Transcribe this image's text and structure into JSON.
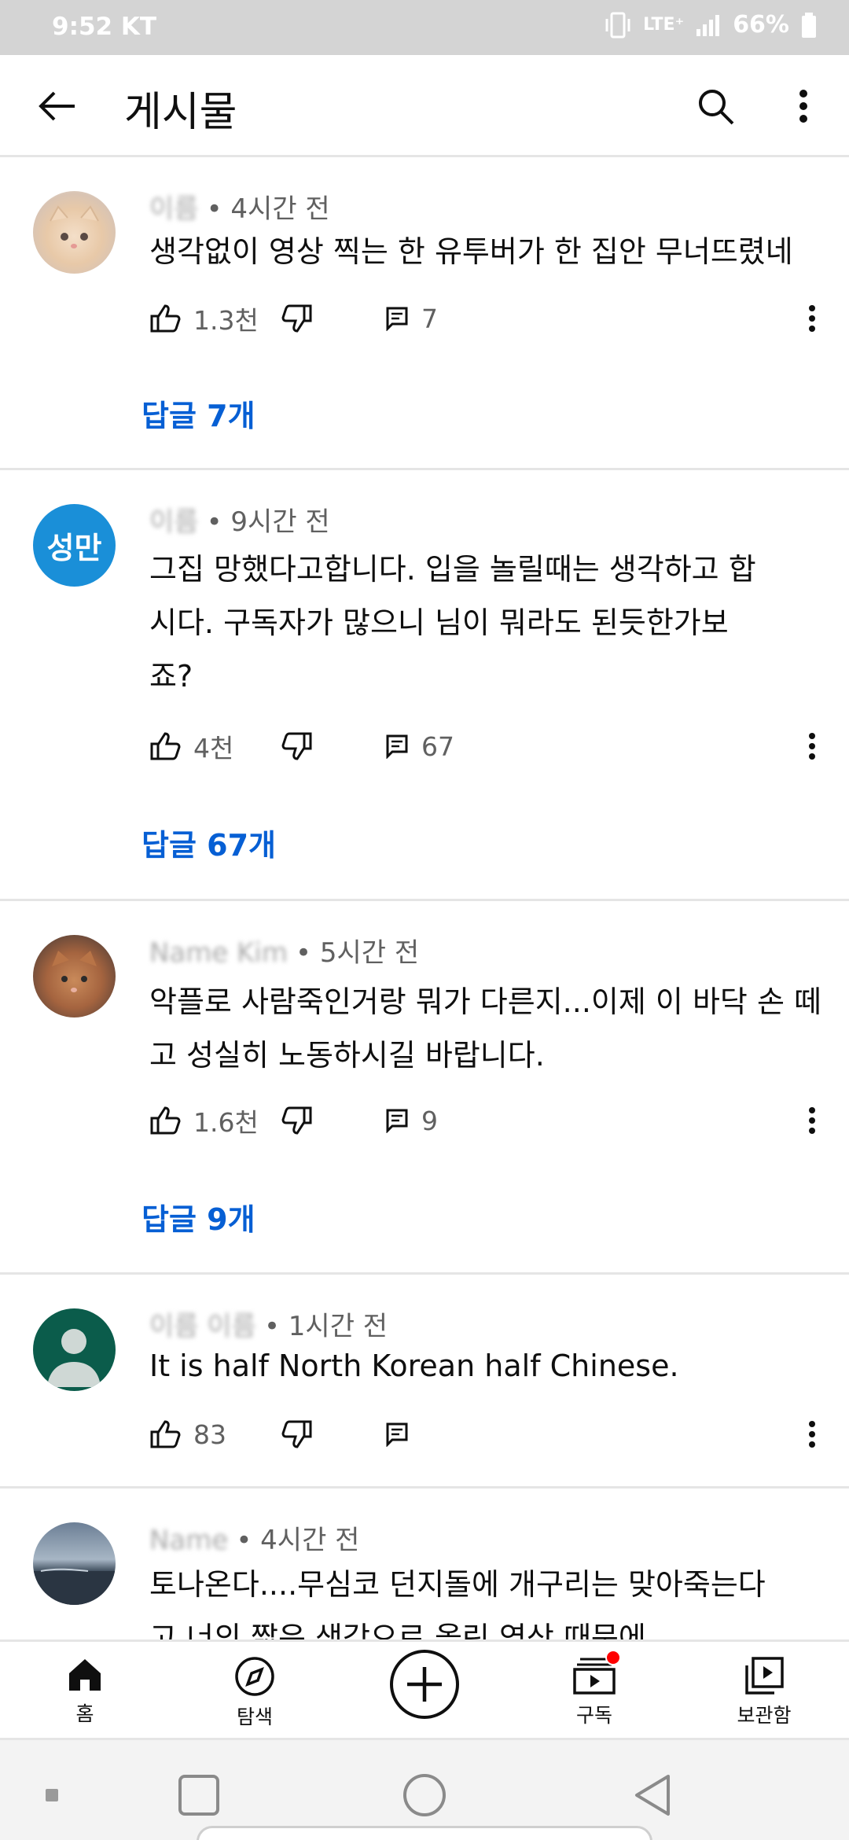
{
  "status_bar": {
    "time_carrier": "9:52 KT",
    "network": "LTE⁺",
    "battery": "66%"
  },
  "app_bar": {
    "title": "게시물"
  },
  "comments": [
    {
      "author": "이름",
      "time": "• 4시간 전",
      "text": "생각없이 영상 찍는 한 유투버가 한 집안 무너뜨렸네",
      "likes": "1.3천",
      "reply_count": "7",
      "replies_label": "답글 7개"
    },
    {
      "author": "이름",
      "time": "• 9시간 전",
      "avatar_text": "성만",
      "text": "그집 망했다고합니다. 입을 놀릴때는 생각하고 합시다. 구독자가 많으니 님이 뭐라도 된듯한가보죠?",
      "likes": "4천",
      "reply_count": "67",
      "replies_label": "답글 67개"
    },
    {
      "author": "Name Kim",
      "time": "• 5시간 전",
      "text": "악플로 사람죽인거랑 뭐가 다른지...이제 이 바닥 손 떼고 성실히 노동하시길 바랍니다.",
      "likes": "1.6천",
      "reply_count": "9",
      "replies_label": "답글 9개"
    },
    {
      "author": "이름 이름",
      "time": "• 1시간 전",
      "text": "It is half North Korean half Chinese.",
      "likes": "83",
      "reply_count": ""
    },
    {
      "author": "Name",
      "time": "• 4시간 전",
      "text": "토나온다....무심코 던지돌에 개구리는 맞아죽는다고 너의 짧은 생각으로 올린 영상 때문에"
    }
  ],
  "bottom_nav": [
    {
      "label": "홈",
      "icon": "home-icon"
    },
    {
      "label": "탐색",
      "icon": "compass-icon"
    },
    {
      "label": "",
      "icon": "add-icon"
    },
    {
      "label": "구독",
      "icon": "subscriptions-icon"
    },
    {
      "label": "보관함",
      "icon": "library-icon"
    }
  ],
  "colors": {
    "link": "#065fd4",
    "avatar_blue": "#1a8fd8",
    "avatar_green": "#0b5c4b",
    "notification": "#ff0000"
  }
}
